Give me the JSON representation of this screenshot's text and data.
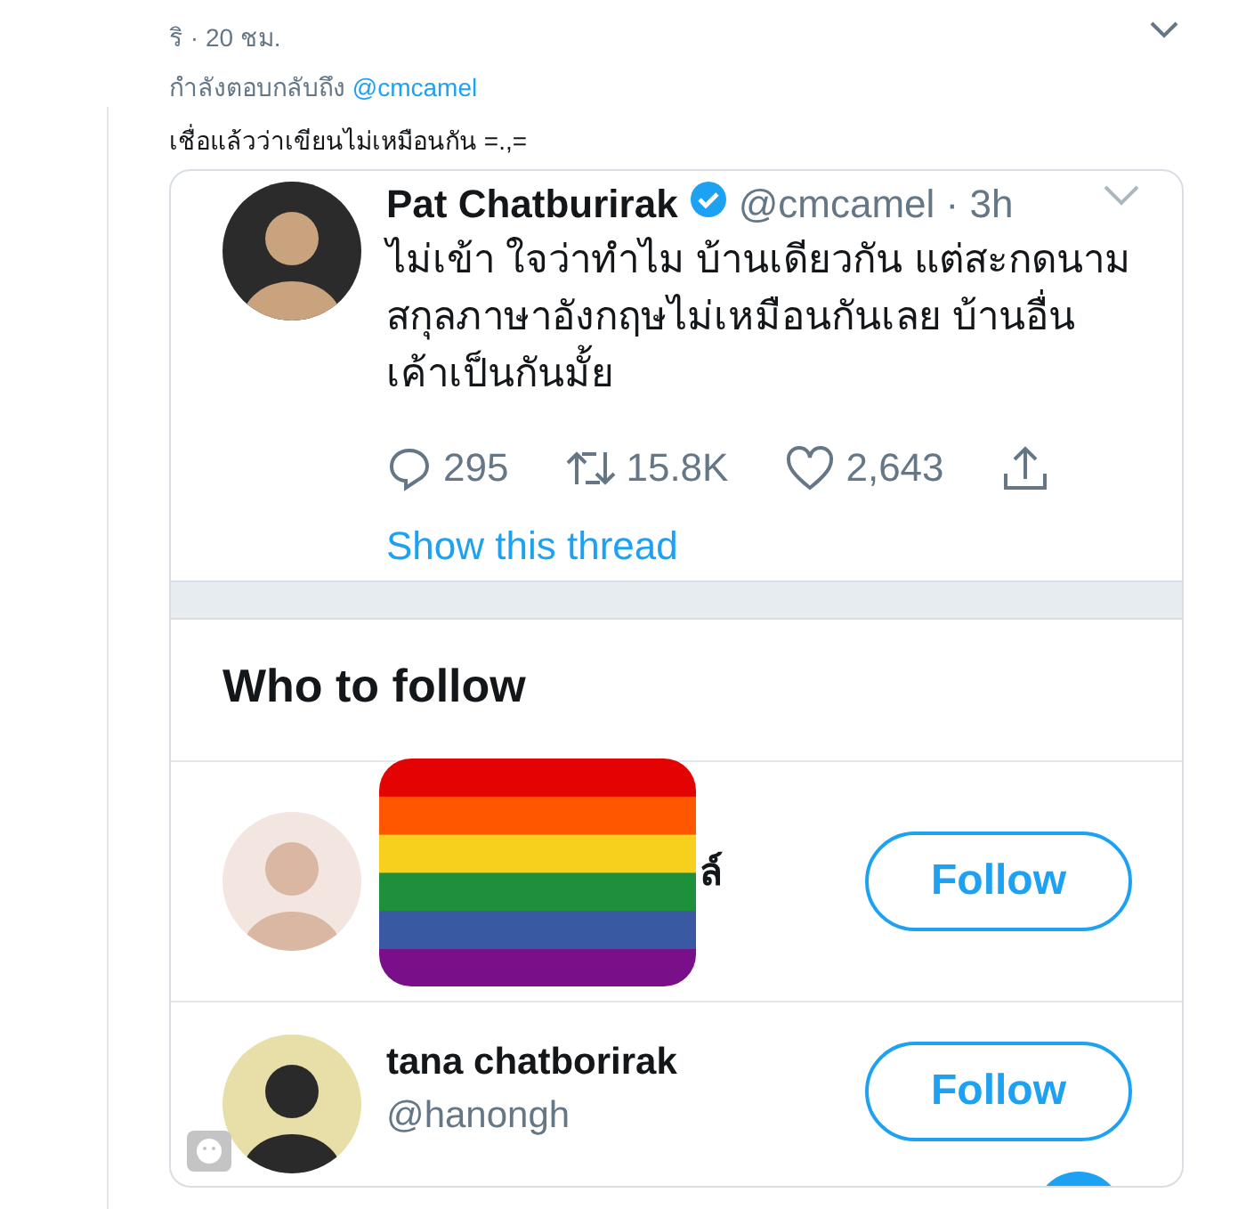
{
  "reply": {
    "meta": "ริ · 20 ชม.",
    "replying_to_prefix": "กำลังตอบกลับถึง",
    "replying_to_handle": "@cmcamel",
    "text": "เชื่อแล้วว่าเขียนไม่เหมือนกัน =.,="
  },
  "embedded": {
    "tweet": {
      "name": "Pat Chatburirak",
      "verified": true,
      "handle": "@cmcamel · 3h",
      "text": "ไม่เข้า ใจว่าทำไม บ้านเดียวกัน แต่สะกดนาม\nสกุลภาษาอังกฤษไม่เหมือนกันเลย บ้านอื่น\nเค้าเป็นกันมั้ย",
      "replies": "295",
      "retweets": "15.8K",
      "likes": "2,643",
      "thread_link": "Show this thread"
    },
    "who_to_follow": {
      "title": "Who to follow",
      "accounts": [
        {
          "kind": "covered",
          "name": "ล์",
          "button": "Follow"
        },
        {
          "kind": "plain",
          "name": "tana chatborirak",
          "handle": "@hanongh",
          "button": "Follow"
        }
      ]
    }
  }
}
